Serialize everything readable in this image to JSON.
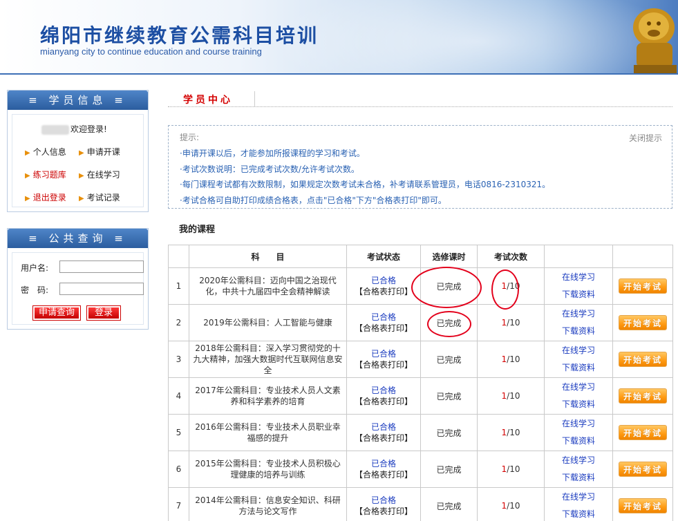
{
  "header": {
    "title": "绵阳市继续教育公需科目培训",
    "subtitle": "mianyang city to continue education and course training"
  },
  "student_info": {
    "heading": "≡ 学员信息 ≡",
    "welcome": "欢迎登录!",
    "menu": [
      "个人信息",
      "申请开课",
      "练习题库",
      "在线学习",
      "退出登录",
      "考试记录"
    ]
  },
  "public_query": {
    "heading": "≡ 公共查询 ≡",
    "username_label": "用户名:",
    "password_label": "密　码:",
    "query_button": "申请查询",
    "login_button": "登录"
  },
  "main": {
    "tab_title": "学员中心",
    "tips": {
      "label": "提示:",
      "close": "关闭提示",
      "lines": [
        "·申请开课以后，才能参加所报课程的学习和考试。",
        "·考试次数说明：已完成考试次数/允许考试次数。",
        "·每门课程考试都有次数限制，如果规定次数考试未合格，补考请联系管理员，电话0816-2310321。",
        "·考试合格可自助打印成绩合格表，点击\"已合格\"下方\"合格表打印\"即可。"
      ]
    },
    "my_courses_title": "我的课程",
    "table": {
      "headers": [
        "",
        "科　　目",
        "考试状态",
        "选修课时",
        "考试次数",
        "",
        ""
      ],
      "rows": [
        {
          "no": "1",
          "subject": "2020年公需科目：迈向中国之治现代化，中共十九届四中全会精神解读",
          "status": "已合格",
          "print": "【合格表打印】",
          "hours": "已完成",
          "done": "1",
          "allowed": "/10",
          "study": "在线学习",
          "download": "下载资料",
          "exam": "开始考试"
        },
        {
          "no": "2",
          "subject": "2019年公需科目：人工智能与健康",
          "status": "已合格",
          "print": "【合格表打印】",
          "hours": "已完成",
          "done": "1",
          "allowed": "/10",
          "study": "在线学习",
          "download": "下载资料",
          "exam": "开始考试"
        },
        {
          "no": "3",
          "subject": "2018年公需科目：深入学习贯彻党的十九大精神，加强大数据时代互联网信息安全",
          "status": "已合格",
          "print": "【合格表打印】",
          "hours": "已完成",
          "done": "1",
          "allowed": "/10",
          "study": "在线学习",
          "download": "下载资料",
          "exam": "开始考试"
        },
        {
          "no": "4",
          "subject": "2017年公需科目：专业技术人员人文素养和科学素养的培育",
          "status": "已合格",
          "print": "【合格表打印】",
          "hours": "已完成",
          "done": "1",
          "allowed": "/10",
          "study": "在线学习",
          "download": "下载资料",
          "exam": "开始考试"
        },
        {
          "no": "5",
          "subject": "2016年公需科目：专业技术人员职业幸福感的提升",
          "status": "已合格",
          "print": "【合格表打印】",
          "hours": "已完成",
          "done": "1",
          "allowed": "/10",
          "study": "在线学习",
          "download": "下载资料",
          "exam": "开始考试"
        },
        {
          "no": "6",
          "subject": "2015年公需科目：专业技术人员积极心理健康的培养与训练",
          "status": "已合格",
          "print": "【合格表打印】",
          "hours": "已完成",
          "done": "1",
          "allowed": "/10",
          "study": "在线学习",
          "download": "下载资料",
          "exam": "开始考试"
        },
        {
          "no": "7",
          "subject": "2014年公需科目：信息安全知识、科研方法与论文写作",
          "status": "已合格",
          "print": "【合格表打印】",
          "hours": "已完成",
          "done": "1",
          "allowed": "/10",
          "study": "在线学习",
          "download": "下载资料",
          "exam": "开始考试"
        }
      ]
    }
  },
  "colors": {
    "brand_blue": "#1d4fa3",
    "accent_red": "#d40000",
    "link_blue": "#1a3bbf",
    "exam_orange": "#ff9a12"
  }
}
